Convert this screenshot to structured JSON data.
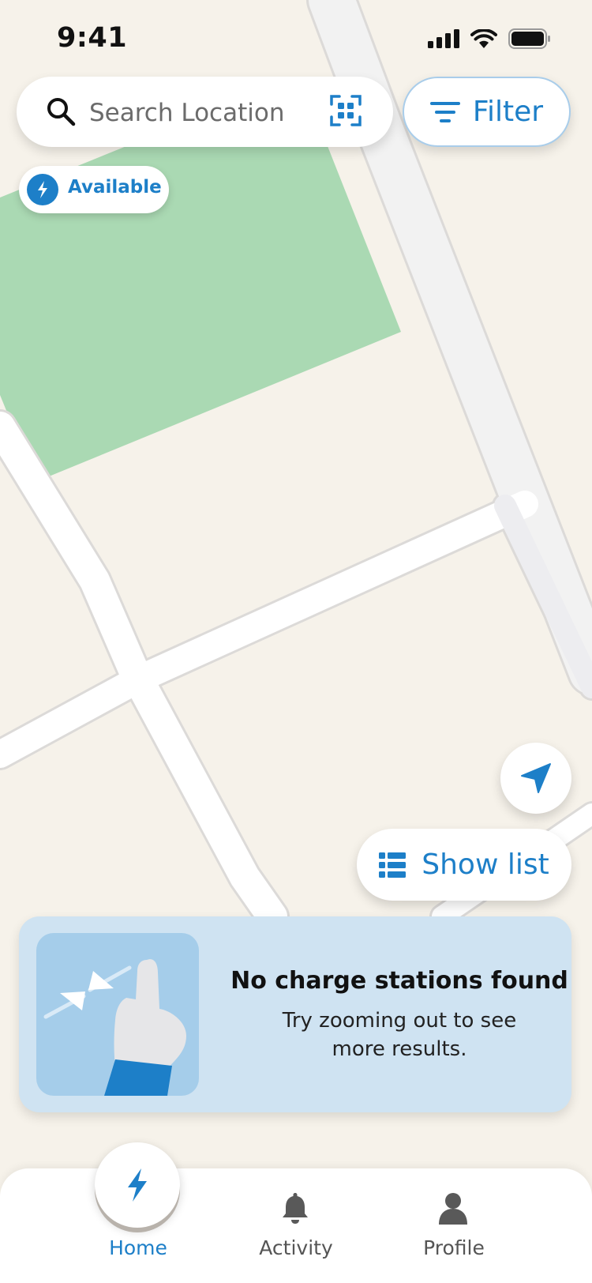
{
  "status_bar": {
    "time": "9:41",
    "icons": [
      "cellular-signal-icon",
      "wifi-icon",
      "battery-icon"
    ]
  },
  "search": {
    "placeholder": "Search Location",
    "value": ""
  },
  "filter": {
    "label": "Filter"
  },
  "availability_chip": {
    "label": "Available"
  },
  "show_list": {
    "label": "Show list"
  },
  "empty_state": {
    "title": "No charge stations found",
    "subtitle": "Try zooming out to see more results."
  },
  "tab_bar": {
    "items": [
      {
        "label": "Home",
        "icon": "lightning-bolt-icon",
        "active": true
      },
      {
        "label": "Activity",
        "icon": "bell-icon",
        "active": false
      },
      {
        "label": "Profile",
        "icon": "person-icon",
        "active": false
      }
    ]
  },
  "colors": {
    "accent": "#1d7fc8",
    "map_background": "#f6f2ea",
    "park": "#aad9b3",
    "card_background": "#cfe3f2"
  }
}
